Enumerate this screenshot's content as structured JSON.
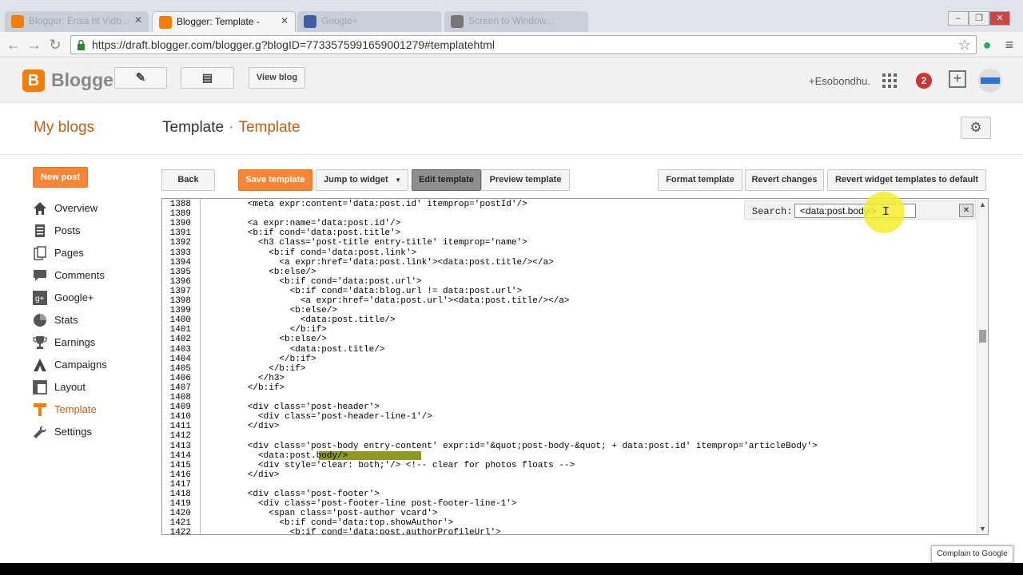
{
  "browser": {
    "tabs": [
      {
        "title": "Blogger: Ensa ht Vidb...",
        "active": false,
        "icon": "blogger-icon",
        "color": "#f57d00"
      },
      {
        "title": "Blogger: Template -",
        "active": true,
        "icon": "blogger-icon",
        "color": "#f57d00"
      },
      {
        "title": "Google+",
        "active": false,
        "icon": "google-plus-icon",
        "color": "#3f5fa0"
      },
      {
        "title": "Screen to Window...",
        "active": false,
        "icon": "window-icon",
        "color": "#777777"
      }
    ],
    "url": "https://draft.blogger.com/blogger.g?blogID=7733575991659001279#templatehtml"
  },
  "appbar": {
    "logo": "Blogger",
    "view_blog": "View blog",
    "user": "+Esobondhu.",
    "notifications": "2"
  },
  "header": {
    "my_blogs": "My blogs",
    "crumb_blog": "Template",
    "crumb_sep": "·",
    "crumb_page": "Template"
  },
  "sidebar": {
    "new_post": "New post",
    "items": [
      {
        "label": "Overview",
        "icon": "home-icon"
      },
      {
        "label": "Posts",
        "icon": "posts-icon"
      },
      {
        "label": "Pages",
        "icon": "pages-icon"
      },
      {
        "label": "Comments",
        "icon": "comments-icon"
      },
      {
        "label": "Google+",
        "icon": "google-plus-icon"
      },
      {
        "label": "Stats",
        "icon": "stats-icon"
      },
      {
        "label": "Earnings",
        "icon": "trophy-icon"
      },
      {
        "label": "Campaigns",
        "icon": "campaigns-icon"
      },
      {
        "label": "Layout",
        "icon": "layout-icon"
      },
      {
        "label": "Template",
        "icon": "template-icon",
        "current": true
      },
      {
        "label": "Settings",
        "icon": "wrench-icon"
      }
    ]
  },
  "toolbar": {
    "back": "Back",
    "save": "Save template",
    "jump": "Jump to widget",
    "edit": "Edit template",
    "preview": "Preview template",
    "format": "Format template",
    "revert": "Revert changes",
    "revert_widget": "Revert widget templates to default"
  },
  "search": {
    "label": "Search:",
    "value": "<data:post.body/>"
  },
  "editor": {
    "lines": [
      {
        "n": "1388",
        "t": "        <meta expr:content='data:post.id' itemprop='postId'/>"
      },
      {
        "n": "1389",
        "t": ""
      },
      {
        "n": "1390",
        "t": "        <a expr:name='data:post.id'/>"
      },
      {
        "n": "1391",
        "t": "        <b:if cond='data:post.title'>"
      },
      {
        "n": "1392",
        "t": "          <h3 class='post-title entry-title' itemprop='name'>"
      },
      {
        "n": "1393",
        "t": "            <b:if cond='data:post.link'>"
      },
      {
        "n": "1394",
        "t": "              <a expr:href='data:post.link'><data:post.title/></a>"
      },
      {
        "n": "1395",
        "t": "            <b:else/>"
      },
      {
        "n": "1396",
        "t": "              <b:if cond='data:post.url'>"
      },
      {
        "n": "1397",
        "t": "                <b:if cond='data:blog.url != data:post.url'>"
      },
      {
        "n": "1398",
        "t": "                  <a expr:href='data:post.url'><data:post.title/></a>"
      },
      {
        "n": "1399",
        "t": "                <b:else/>"
      },
      {
        "n": "1400",
        "t": "                  <data:post.title/>"
      },
      {
        "n": "1401",
        "t": "                </b:if>"
      },
      {
        "n": "1402",
        "t": "              <b:else/>"
      },
      {
        "n": "1403",
        "t": "                <data:post.title/>"
      },
      {
        "n": "1404",
        "t": "              </b:if>"
      },
      {
        "n": "1405",
        "t": "            </b:if>"
      },
      {
        "n": "1406",
        "t": "          </h3>"
      },
      {
        "n": "1407",
        "t": "        </b:if>"
      },
      {
        "n": "1408",
        "t": ""
      },
      {
        "n": "1409",
        "t": "        <div class='post-header'>"
      },
      {
        "n": "1410",
        "t": "          <div class='post-header-line-1'/>"
      },
      {
        "n": "1411",
        "t": "        </div>"
      },
      {
        "n": "1412",
        "t": ""
      },
      {
        "n": "1413",
        "t": "        <div class='post-body entry-content' expr:id='&quot;post-body-&quot; + data:post.id' itemprop='articleBody'>"
      },
      {
        "n": "1414",
        "t": "          <data:post.body/>"
      },
      {
        "n": "1415",
        "t": "          <div style='clear: both;'/> <!-- clear for photos floats -->"
      },
      {
        "n": "1416",
        "t": "        </div>"
      },
      {
        "n": "1417",
        "t": ""
      },
      {
        "n": "1418",
        "t": "        <div class='post-footer'>"
      },
      {
        "n": "1419",
        "t": "          <div class='post-footer-line post-footer-line-1'>"
      },
      {
        "n": "1420",
        "t": "            <span class='post-author vcard'>"
      },
      {
        "n": "1421",
        "t": "              <b:if cond='data:top.showAuthor'>"
      },
      {
        "n": "1422",
        "t": "                <b:if cond='data:post.authorProfileUrl'>"
      }
    ]
  },
  "complain": "Complain to Google",
  "colors": {
    "accent": "#f98535",
    "link_orange": "#c05f14",
    "highlight": "#8c9a20"
  }
}
